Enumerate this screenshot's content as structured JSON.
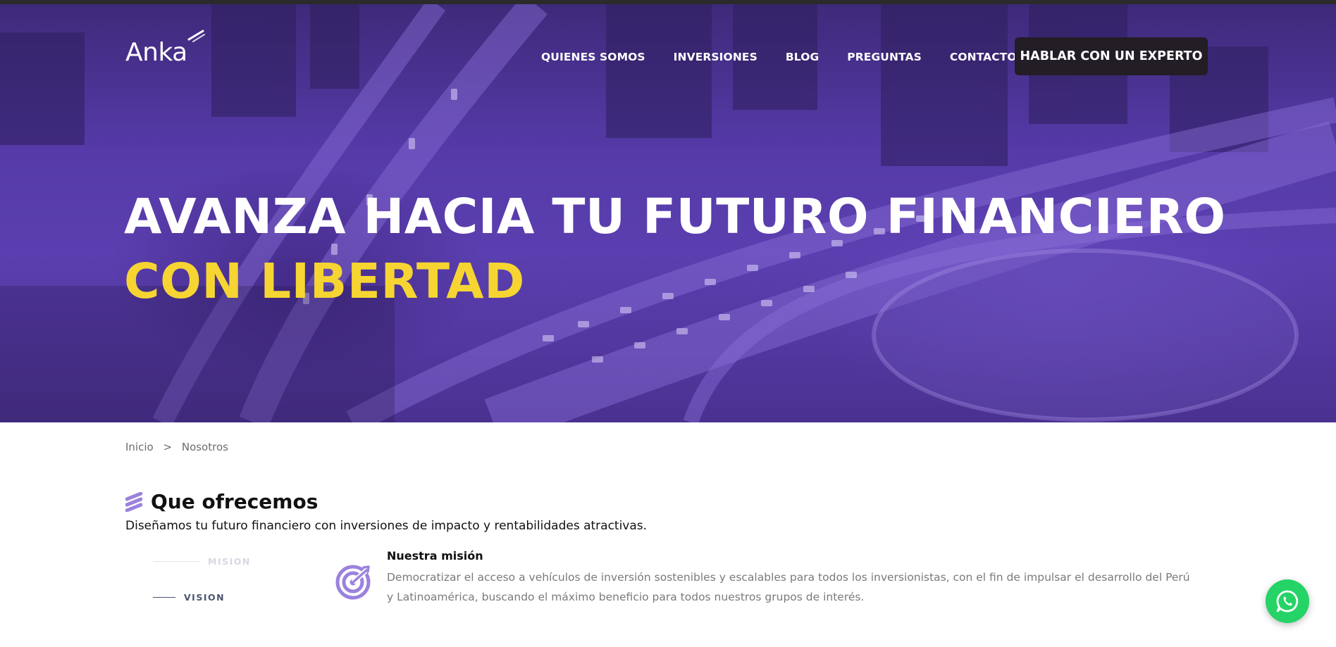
{
  "header": {
    "logo_text": "Anka",
    "nav": [
      "QUIENES SOMOS",
      "INVERSIONES",
      "BLOG",
      "PREGUNTAS",
      "CONTACTO"
    ],
    "cta_label": "HABLAR CON UN EXPERTO"
  },
  "hero": {
    "headline_line1": "AVANZA HACIA TU FUTURO FINANCIERO",
    "headline_line2": "CON LIBERTAD"
  },
  "breadcrumb": {
    "home": "Inicio",
    "separator": ">",
    "current": "Nosotros"
  },
  "offer": {
    "title": "Que ofrecemos",
    "subtitle": "Diseñamos tu futuro financiero con inversiones de impacto y rentabilidades atractivas.",
    "tabs": [
      "MISION",
      "VISION"
    ],
    "mission_title": "Nuestra misión",
    "mission_text": "Democratizar el acceso a vehículos de inversión sostenibles y escalables para todos los inversionistas, con el fin de impulsar el desarrollo del Perú y Latinoamérica, buscando el máximo beneficio para todos nuestros grupos de interés."
  },
  "colors": {
    "hero_overlay": "#5b3fb0",
    "accent_yellow": "#f6d532",
    "cta_bg": "#231d25",
    "icon_purple": "#9b82dd",
    "whatsapp_green": "#25d366"
  },
  "icons": [
    "logo-mark-icon",
    "section-title-icon",
    "target-icon",
    "whatsapp-icon"
  ]
}
